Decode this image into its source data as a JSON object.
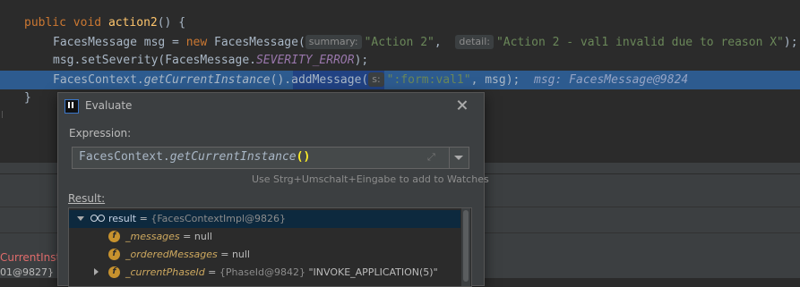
{
  "editor": {
    "line1": {
      "kw": "public",
      "kw2": "void",
      "fn": "action2",
      "rest": "() {"
    },
    "line2": {
      "type": "FacesMessage msg = ",
      "kw": "new",
      "ctor": " FacesMessage(",
      "hint1": "summary:",
      "arg1": "\"Action 2\"",
      "comma": ",",
      "hint2": "detail:",
      "arg2": "\"Action 2 - val1 invalid due to reason X\"",
      "end": ");"
    },
    "line3": {
      "call": "msg.setSeverity(FacesMessage.",
      "const": "SEVERITY_ERROR",
      "end": ");"
    },
    "line4": {
      "cls": "FacesContext.",
      "method": "getCurrentInstance",
      "parens": "()",
      "call": ".addMessage(",
      "hint": "s:",
      "arg": "\":form:val1\"",
      "rest": ", msg);",
      "inline_value": "msg: FacesMessage@9824"
    },
    "line5": {
      "text": "}"
    }
  },
  "dialog": {
    "title": "Evaluate",
    "expression_label": "Expression:",
    "expression": {
      "prefix": "FacesContext.",
      "method": "getCurrentInstance",
      "paren": "()"
    },
    "hint": "Use Strg+Umschalt+Eingabe to add to Watches",
    "result_label": "Result:",
    "tree": [
      {
        "name": "result",
        "eq": " = ",
        "value": "{FacesContextImpl@9826}"
      },
      {
        "name": "_messages",
        "eq": " = ",
        "value": "null"
      },
      {
        "name": "_orderedMessages",
        "eq": " = ",
        "value": "null"
      },
      {
        "name": "_currentPhaseId",
        "eq": " = ",
        "value": "{PhaseId@9842}",
        "extra": " \"INVOKE_APPLICATION(5)\""
      }
    ]
  },
  "frames": {
    "frame1": "CurrentInstar",
    "frame2": "01@9827} \"M"
  },
  "colors": {
    "exec_line": "#2d5b8f",
    "field_icon": "#c7922e",
    "error_frame": "#e06c6c"
  },
  "icons": [
    "watch-icon",
    "field-icon",
    "close-icon",
    "expand-icon",
    "dropdown-arrow-icon",
    "app-icon"
  ]
}
